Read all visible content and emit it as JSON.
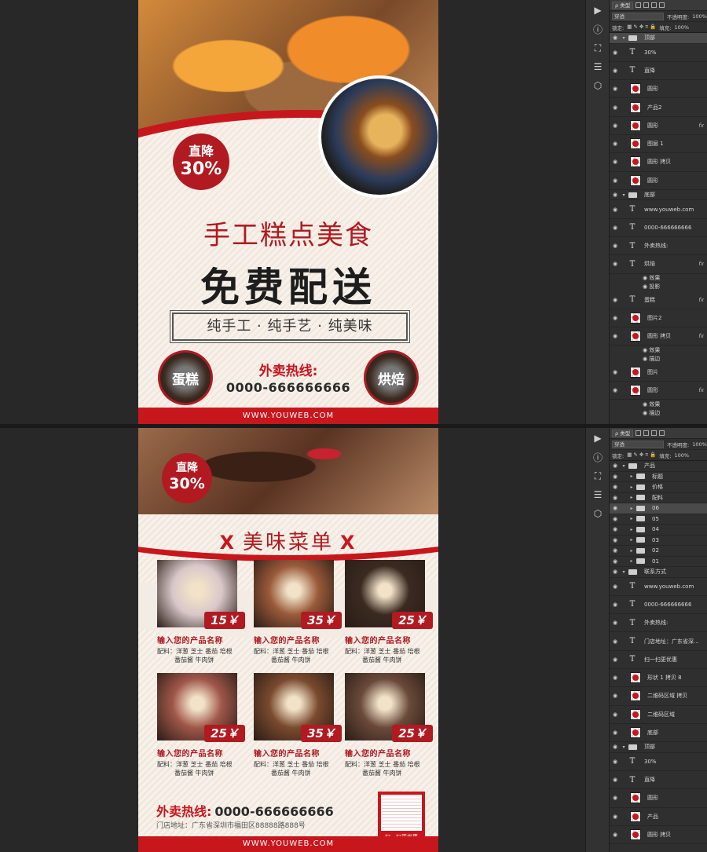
{
  "top": {
    "poster": {
      "badge": {
        "line1": "直降",
        "line2": "30%"
      },
      "title1": "手工糕点美食",
      "title2": "免费配送",
      "tagline": "纯手工 · 纯手艺 · 纯美味",
      "left_circle": "蛋糕",
      "right_circle": "烘焙",
      "hotline_label": "外卖热线:",
      "phone": "0000-666666666",
      "footer_url": "WWW.YOUWEB.COM"
    },
    "layers_panel": {
      "kind_filter": "ρ 类型",
      "blend_mode": "穿透",
      "opacity_label": "不透明度:",
      "opacity": "100%",
      "lock_label": "锁定:",
      "fill_label": "填充:",
      "fill": "100%",
      "layers": [
        {
          "type": "folder",
          "name": "顶部",
          "highlight": true
        },
        {
          "type": "text",
          "name": "30%"
        },
        {
          "type": "text",
          "name": "直降"
        },
        {
          "type": "image",
          "name": "圆形"
        },
        {
          "type": "image",
          "name": "产品2"
        },
        {
          "type": "image",
          "name": "圆形",
          "fx": "fx"
        },
        {
          "type": "image",
          "name": "图层 1"
        },
        {
          "type": "image",
          "name": "圆形 拷贝"
        },
        {
          "type": "image",
          "name": "圆形"
        },
        {
          "type": "folder",
          "name": "底部"
        },
        {
          "type": "text",
          "name": "www.youweb.com"
        },
        {
          "type": "text",
          "name": "0000-666666666"
        },
        {
          "type": "text",
          "name": "外卖热线:"
        },
        {
          "type": "text",
          "name": "烘焙",
          "fx": "fx"
        },
        {
          "type": "sub",
          "name": "效果"
        },
        {
          "type": "sub",
          "name": "投影"
        },
        {
          "type": "text",
          "name": "蛋糕",
          "fx": "fx"
        },
        {
          "type": "image",
          "name": "图片2"
        },
        {
          "type": "image",
          "name": "圆形 拷贝",
          "fx": "fx"
        },
        {
          "type": "sub",
          "name": "效果"
        },
        {
          "type": "sub",
          "name": "描边"
        },
        {
          "type": "image",
          "name": "图片"
        },
        {
          "type": "image",
          "name": "圆形",
          "fx": "fx"
        },
        {
          "type": "sub",
          "name": "效果"
        },
        {
          "type": "sub",
          "name": "描边"
        }
      ]
    }
  },
  "bottom": {
    "poster": {
      "badge": {
        "line1": "直降",
        "line2": "30%"
      },
      "title": "美味菜单",
      "x_mark": "X",
      "products": [
        {
          "price": "15￥",
          "name": "输入您的产品名称",
          "desc1": "配料：洋葱 芝士 番茄 培根",
          "desc2": "番茄酱 牛肉饼",
          "color": "#d9c7c9"
        },
        {
          "price": "35￥",
          "name": "输入您的产品名称",
          "desc1": "配料：洋葱 芝士 番茄 培根",
          "desc2": "番茄酱 牛肉饼",
          "color": "#9a5a3a"
        },
        {
          "price": "25￥",
          "name": "输入您的产品名称",
          "desc1": "配料：洋葱 芝士 番茄 培根",
          "desc2": "番茄酱 牛肉饼",
          "color": "#3a2a22"
        },
        {
          "price": "25￥",
          "name": "输入您的产品名称",
          "desc1": "配料：洋葱 芝士 番茄 培根",
          "desc2": "番茄酱 牛肉饼",
          "color": "#a0574a"
        },
        {
          "price": "35￥",
          "name": "输入您的产品名称",
          "desc1": "配料：洋葱 芝士 番茄 培根",
          "desc2": "番茄酱 牛肉饼",
          "color": "#7a4a2e"
        },
        {
          "price": "25￥",
          "name": "输入您的产品名称",
          "desc1": "配料：洋葱 芝士 番茄 培根",
          "desc2": "番茄酱 牛肉饼",
          "color": "#6a4a3a"
        }
      ],
      "hotline_label": "外卖热线:",
      "phone": "0000-666666666",
      "address": "门店地址：广东省深圳市福田区88888路888号",
      "qr_caption": "扫一扫更优惠",
      "footer_url": "WWW.YOUWEB.COM"
    },
    "layers_panel": {
      "kind_filter": "ρ 类型",
      "blend_mode": "穿透",
      "opacity_label": "不透明度:",
      "opacity": "100%",
      "lock_label": "锁定:",
      "fill_label": "填充:",
      "fill": "100%",
      "layers": [
        {
          "type": "folder",
          "name": "产品"
        },
        {
          "type": "subfolder",
          "name": "标题"
        },
        {
          "type": "subfolder",
          "name": "价格"
        },
        {
          "type": "subfolder",
          "name": "配料"
        },
        {
          "type": "subfolder",
          "name": "06",
          "highlight": true
        },
        {
          "type": "subfolder",
          "name": "05"
        },
        {
          "type": "subfolder",
          "name": "04"
        },
        {
          "type": "subfolder",
          "name": "03"
        },
        {
          "type": "subfolder",
          "name": "02"
        },
        {
          "type": "subfolder",
          "name": "01"
        },
        {
          "type": "folder",
          "name": "联系方式"
        },
        {
          "type": "text",
          "name": "www.youweb.com"
        },
        {
          "type": "text",
          "name": "0000-666666666"
        },
        {
          "type": "text",
          "name": "外卖热线:"
        },
        {
          "type": "text",
          "name": "门店地址：广东省深..."
        },
        {
          "type": "text",
          "name": "扫一扫更优惠"
        },
        {
          "type": "image",
          "name": "形状 1 拷贝 8"
        },
        {
          "type": "image",
          "name": "二维码区域 拷贝"
        },
        {
          "type": "image",
          "name": "二维码区域"
        },
        {
          "type": "image",
          "name": "底部"
        },
        {
          "type": "folder",
          "name": "顶部"
        },
        {
          "type": "text",
          "name": "30%"
        },
        {
          "type": "text",
          "name": "直降"
        },
        {
          "type": "image",
          "name": "圆形"
        },
        {
          "type": "image",
          "name": "产品"
        },
        {
          "type": "image",
          "name": "圆形 拷贝"
        }
      ]
    },
    "tool_icons": [
      "play-icon",
      "info-icon",
      "character-icon",
      "adjust-icon",
      "3d-icon"
    ]
  }
}
